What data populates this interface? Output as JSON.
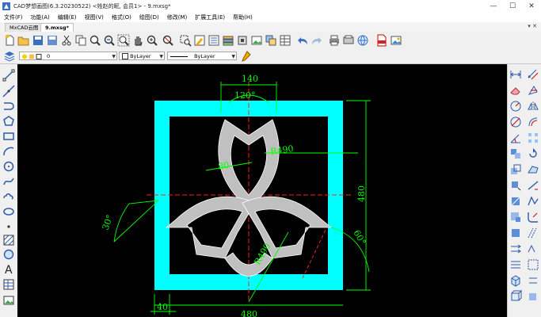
{
  "window": {
    "title": "CAD梦想画图(6.3.20230522) <姓赵的昵, 会员1> - 9.mxsg*",
    "minimize_glyph": "—",
    "maximize_glyph": "☐",
    "close_glyph": "✕"
  },
  "menu": [
    "文件(F)",
    "功能(A)",
    "编辑(E)",
    "视图(V)",
    "格式(O)",
    "绘图(D)",
    "修改(M)",
    "扩展工具(E)",
    "帮助(H)"
  ],
  "tabs": [
    {
      "label": "MxCAD云图"
    },
    {
      "label": "9.mxsg*"
    }
  ],
  "tabbar_right": "▾ ✕",
  "toolbar2": {
    "layer_value": "0",
    "color_value": "ByLayer",
    "linetype_value": "ByLayer"
  },
  "drawing": {
    "dimensions": {
      "top_width": "140",
      "top_angle": "120°",
      "radius": "R490",
      "small_width": "80",
      "height": "480",
      "left_angle": "30°",
      "right_angle": "60°",
      "lower_radius": "R490",
      "bottom_width": "40",
      "bottom_total": "480"
    },
    "colors": {
      "frame": "#00ffff",
      "shape": "#c0c0c0",
      "dimension": "#00ff00",
      "centerline": "#ff2020",
      "background": "#000000"
    }
  }
}
